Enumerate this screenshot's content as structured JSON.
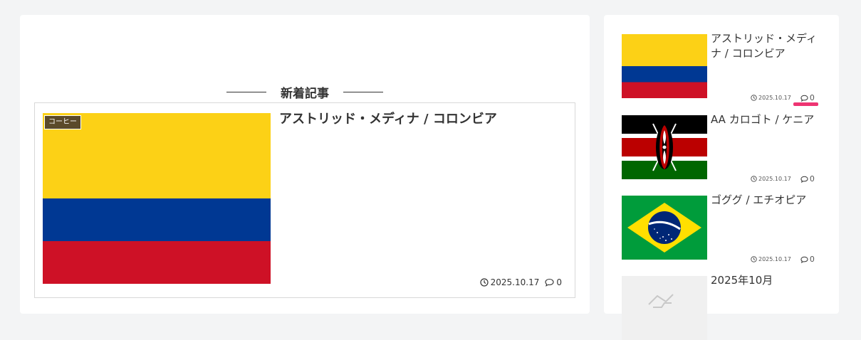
{
  "main": {
    "heading": "新着記事",
    "article": {
      "category": "コーヒー",
      "title": "アストリッド・メディナ / コロンビア",
      "date": "2025.10.17",
      "comments": "0"
    }
  },
  "sidebar": {
    "items": [
      {
        "title": "アストリッド・メディナ / コロンビア",
        "date": "2025.10.17",
        "comments": "0",
        "flag": "colombia-flag"
      },
      {
        "title": "AA カロゴト / ケニア",
        "date": "2025.10.17",
        "comments": "0",
        "flag": "kenya-flag"
      },
      {
        "title": "ゴググ / エチオピア",
        "date": "2025.10.17",
        "comments": "0",
        "flag": "brazil-flag"
      },
      {
        "title": "2025年10月",
        "flag": "placeholder-image"
      }
    ]
  },
  "colors": {
    "colombia_yellow": "#fcd116",
    "colombia_blue": "#003893",
    "colombia_red": "#ce1126",
    "kenya_green": "#006600",
    "kenya_red": "#bb0000",
    "brazil_green": "#009c3b",
    "brazil_yellow": "#ffdf00",
    "brazil_blue": "#002776",
    "badge_brown": "#5b4a2a",
    "highlight_pink": "#ee3472"
  }
}
